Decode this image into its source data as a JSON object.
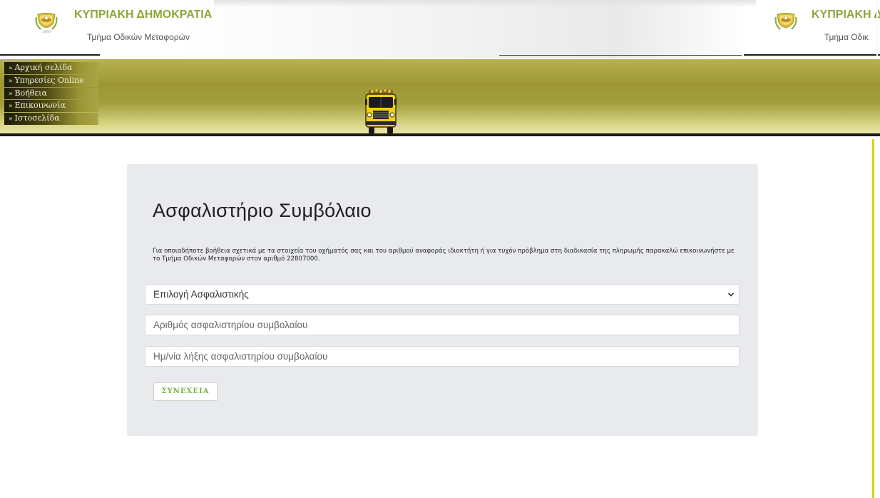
{
  "header": {
    "title": "ΚΥΠΡΙΑΚΗ ΔΗΜΟΚΡΑΤΙΑ",
    "subtitle": "Τμήμα Οδικών Μεταφορών",
    "title_truncated": "ΚΥΠΡΙΑΚΗ Δ",
    "subtitle_truncated": "Τμήμα Οδικ",
    "crest_icon": "cyprus-coat-of-arms-icon",
    "brand_color": "#8fa63a"
  },
  "nav": {
    "items": [
      {
        "label": "Αρχική σελίδα",
        "icon": "raquo"
      },
      {
        "label": "Υπηρεσίες Online",
        "icon": "raquo"
      },
      {
        "label": "Βοήθεια",
        "icon": "raquo"
      },
      {
        "label": "Επικοινωνία",
        "icon": "raquo"
      },
      {
        "label": "Ιστοσελίδα",
        "icon": "raquo"
      }
    ],
    "bullet": "»"
  },
  "banner": {
    "image_icon": "bus-front-icon",
    "gradient_colors": [
      "#9c9634",
      "#e9e7a9"
    ]
  },
  "form": {
    "title": "Ασφαλιστήριο Συμβόλαιο",
    "info_text": "Για οποιαδήποτε βοήθεια σχετικά με τα στοιχεία του οχήματός σας και του αριθμού αναφοράς ιδιοκτήτη ή για τυχόν πρόβλημα στη διαδικασία της πληρωμής παρακαλώ επικοινωνήστε με το Τμήμα Οδικών Μεταφορών στον αριθμό 22807000.",
    "insurer_select": {
      "selected": "Επιλογή Ασφαλιστικής",
      "icon": "chevron-down-icon"
    },
    "policy_number": {
      "value": "",
      "placeholder": "Αριθμός ασφαλιστηρίου συμβολαίου"
    },
    "expiry_date": {
      "value": "",
      "placeholder": "Ημ/νία λήξης ασφαλιστηρίου συμβολαίου"
    },
    "submit_label": "ΣΥΝΕΧΕΙΑ",
    "submit_color": "#78b043",
    "card_background": "#e8eaed"
  }
}
